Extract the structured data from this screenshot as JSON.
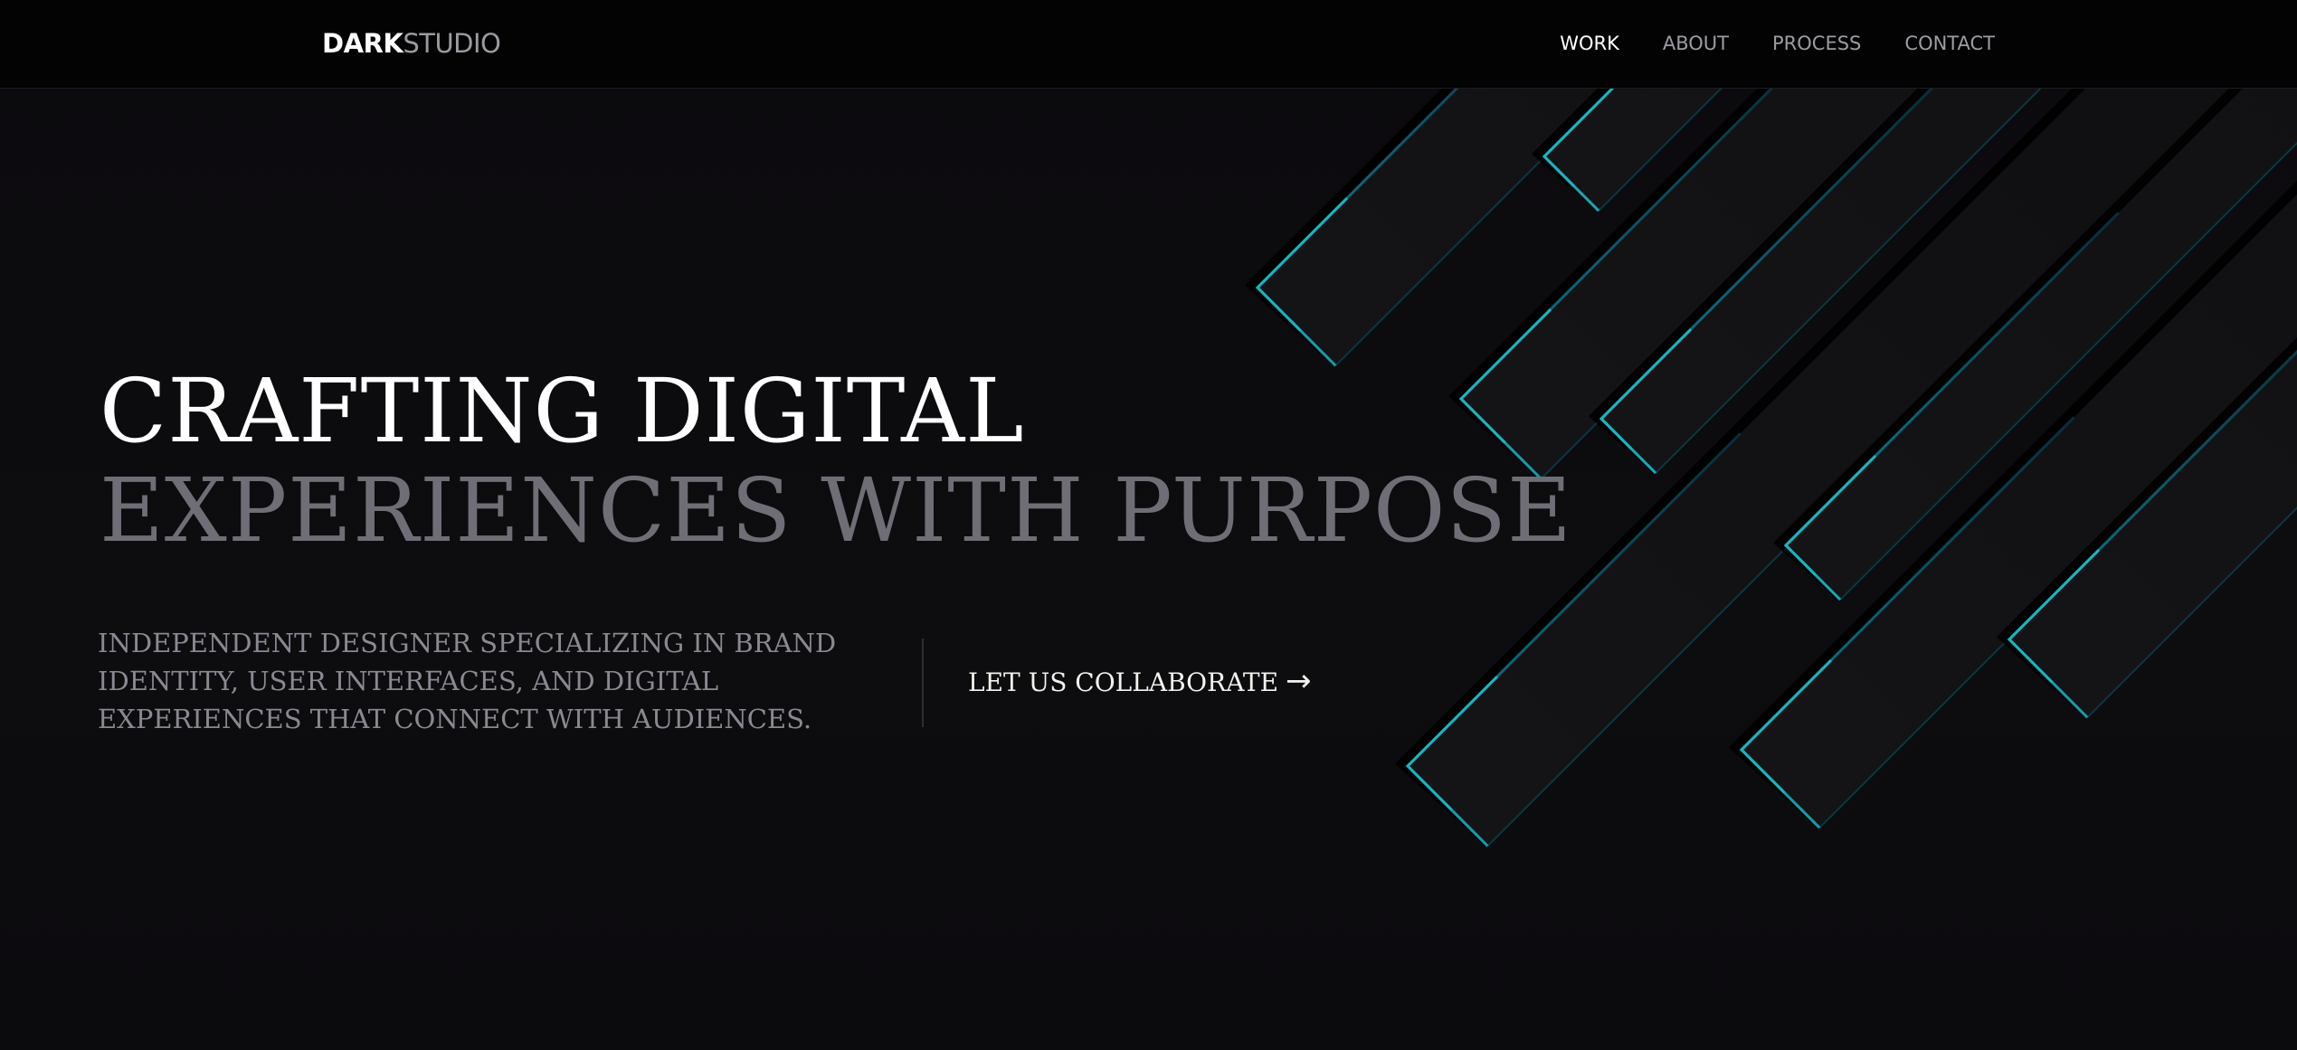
{
  "brand": {
    "bold": "DARK",
    "light": "STUDIO"
  },
  "nav": {
    "items": [
      {
        "label": "WORK"
      },
      {
        "label": "ABOUT"
      },
      {
        "label": "PROCESS"
      },
      {
        "label": "CONTACT"
      }
    ],
    "active": "WORK"
  },
  "hero": {
    "headline_line1": "CRAFTING DIGITAL",
    "headline_line2": "EXPERIENCES WITH PURPOSE",
    "description": "INDEPENDENT DESIGNER SPECIALIZING IN BRAND IDENTITY, USER INTERFACES, AND DIGITAL EXPERIENCES THAT CONNECT WITH AUDIENCES.",
    "cta_label": "LET US COLLABORATE",
    "cta_arrow": "→"
  },
  "colors": {
    "background": "#0c0b0e",
    "accent": "#19b6c0",
    "headline_primary": "#ffffff",
    "headline_secondary": "#6f6e76"
  }
}
